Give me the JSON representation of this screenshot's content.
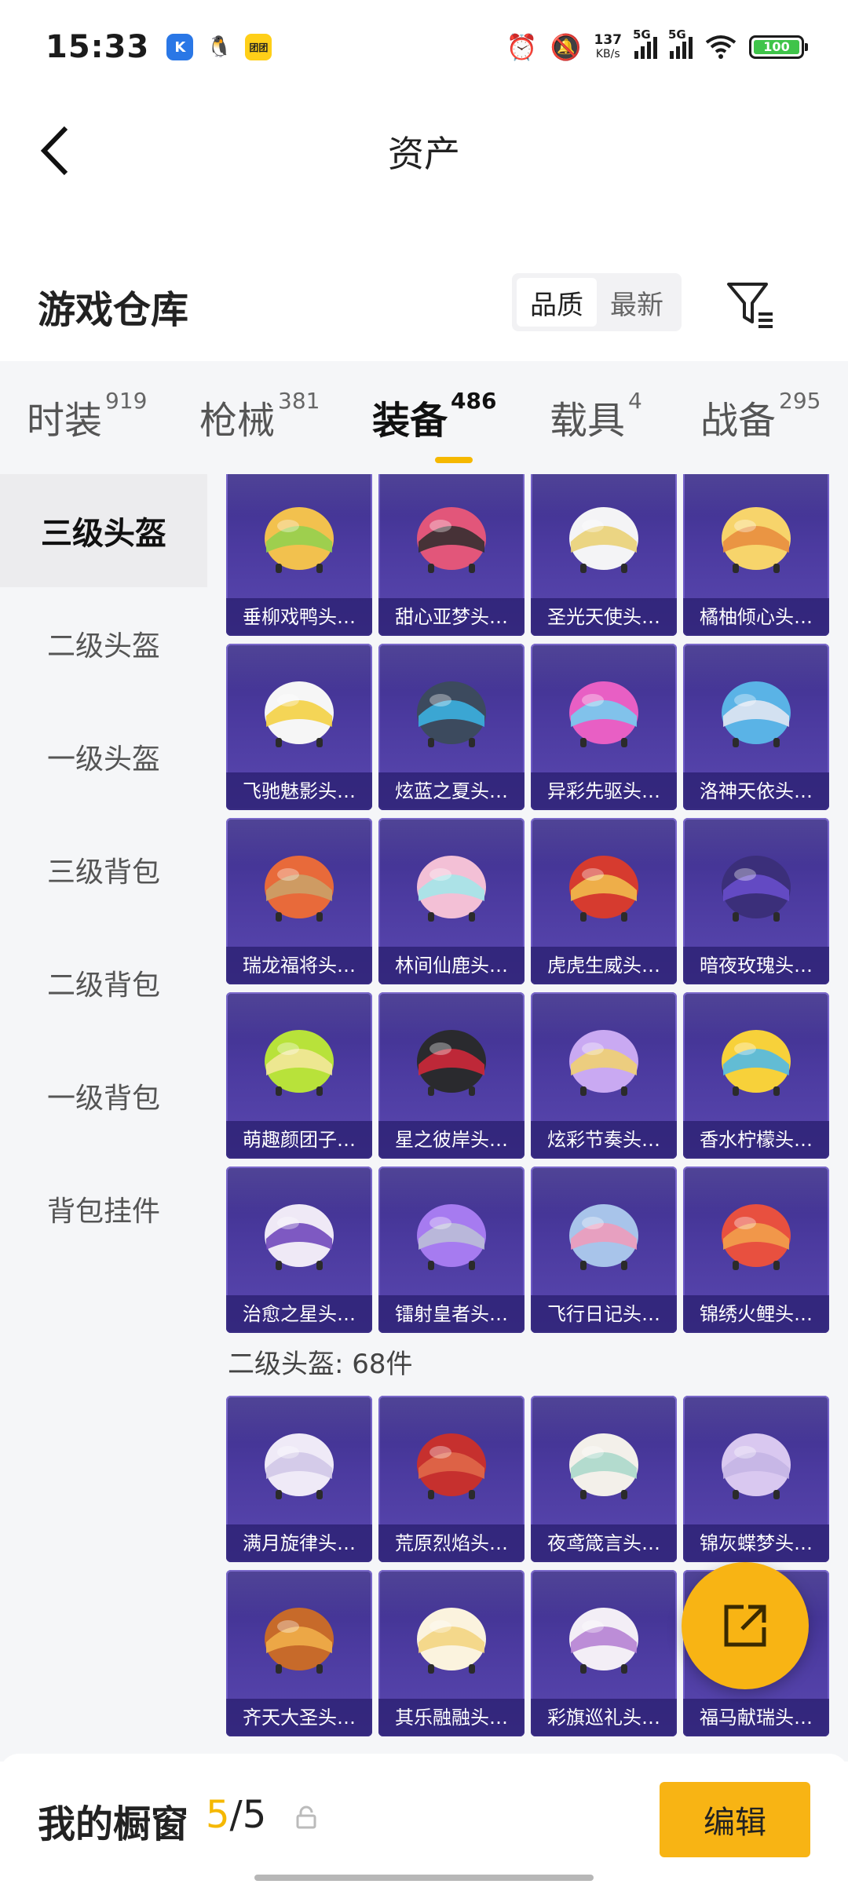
{
  "status_bar": {
    "time": "15:33",
    "apps": [
      "K",
      "🐧",
      "团团"
    ],
    "net_speed_value": "137",
    "net_speed_unit": "KB/s",
    "signal1": "5G",
    "signal2": "5G",
    "battery": "100"
  },
  "header": {
    "title": "资产"
  },
  "warehouse": {
    "title": "游戏仓库",
    "sort_options": [
      "品质",
      "最新"
    ],
    "active_sort": "品质"
  },
  "tabs": [
    {
      "label": "时装",
      "count": "919"
    },
    {
      "label": "枪械",
      "count": "381"
    },
    {
      "label": "装备",
      "count": "486",
      "active": true
    },
    {
      "label": "载具",
      "count": "4"
    },
    {
      "label": "战备",
      "count": "295"
    }
  ],
  "sidebar": [
    "三级头盔",
    "二级头盔",
    "一级头盔",
    "三级背包",
    "二级背包",
    "一级背包",
    "背包挂件"
  ],
  "grid": {
    "level3_items": [
      "垂柳戏鸭头…",
      "甜心亚梦头…",
      "圣光天使头…",
      "橘柚倾心头…",
      "飞驰魅影头…",
      "炫蓝之夏头…",
      "异彩先驱头…",
      "洛神天依头…",
      "瑞龙福将头…",
      "林间仙鹿头…",
      "虎虎生威头…",
      "暗夜玫瑰头…",
      "萌趣颜团子…",
      "星之彼岸头…",
      "炫彩节奏头…",
      "香水柠檬头…",
      "治愈之星头…",
      "镭射皇者头…",
      "飞行日记头…",
      "锦绣火鲤头…"
    ],
    "section_label": "二级头盔: 68件",
    "level2_items": [
      "满月旋律头…",
      "荒原烈焰头…",
      "夜鸢箴言头…",
      "锦灰蝶梦头…",
      "齐天大圣头…",
      "其乐融融头…",
      "彩旗巡礼头…",
      "福马献瑞头…"
    ]
  },
  "bottom_bar": {
    "label": "我的橱窗",
    "current": "5",
    "total": "/5",
    "edit_label": "编辑"
  },
  "colors": {
    "accent": "#f8b414",
    "card_bg": "#4b3a9f"
  }
}
